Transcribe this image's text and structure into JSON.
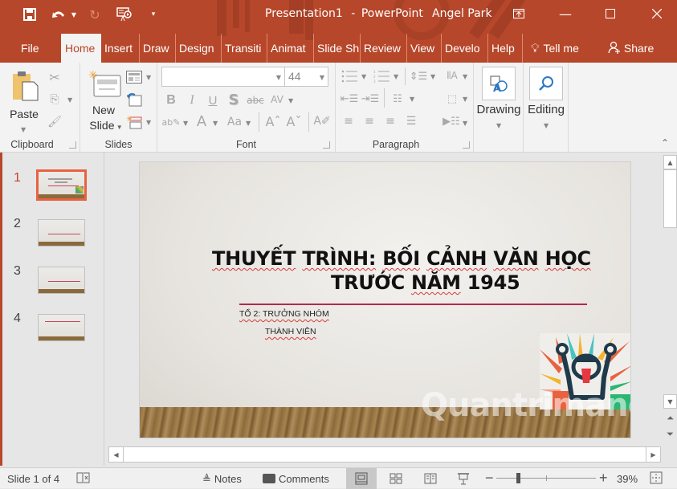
{
  "app": {
    "document_name": "Presentation1",
    "separator": "-",
    "app_name": "PowerPoint",
    "user": "Angel Park",
    "accent": "#b7472a"
  },
  "qat": {
    "icons": [
      "save-icon",
      "undo-icon",
      "redo-icon",
      "start-from-beginning-icon",
      "customize-qat-icon"
    ]
  },
  "tabs": [
    {
      "label": "File"
    },
    {
      "label": "Home",
      "active": true
    },
    {
      "label": "Insert"
    },
    {
      "label": "Draw"
    },
    {
      "label": "Design"
    },
    {
      "label": "Transiti"
    },
    {
      "label": "Animat"
    },
    {
      "label": "Slide Sh"
    },
    {
      "label": "Review"
    },
    {
      "label": "View"
    },
    {
      "label": "Develo"
    },
    {
      "label": "Help"
    }
  ],
  "tell_me": "Tell me",
  "share": "Share",
  "ribbon": {
    "clipboard": {
      "label": "Clipboard",
      "paste": "Paste"
    },
    "slides": {
      "label": "Slides",
      "new_slide_line1": "New",
      "new_slide_line2": "Slide"
    },
    "font": {
      "label": "Font",
      "font_name": "",
      "font_size": "44"
    },
    "paragraph": {
      "label": "Paragraph"
    },
    "drawing": {
      "label": "Drawing"
    },
    "editing": {
      "label": "Editing"
    }
  },
  "thumbnails": [
    {
      "number": "1",
      "selected": true
    },
    {
      "number": "2"
    },
    {
      "number": "3"
    },
    {
      "number": "4"
    }
  ],
  "slide": {
    "title_line1": [
      "THUYẾT",
      "TRÌNH:",
      "BỐI",
      "CẢNH",
      "VĂN",
      "HỌC"
    ],
    "title_line2": [
      "TRƯỚC",
      "NĂM",
      "1945"
    ],
    "subtitle_line1": "TỔ 2: TRƯỞNG NHÓM",
    "subtitle_line2": "THÀNH VIÊN",
    "accent_line_color": "#b5294c"
  },
  "watermark": "Quantrimang",
  "status": {
    "slide_info": "Slide 1 of 4",
    "notes": "Notes",
    "comments": "Comments",
    "zoom": "39%",
    "zoom_fraction": 0.22
  }
}
